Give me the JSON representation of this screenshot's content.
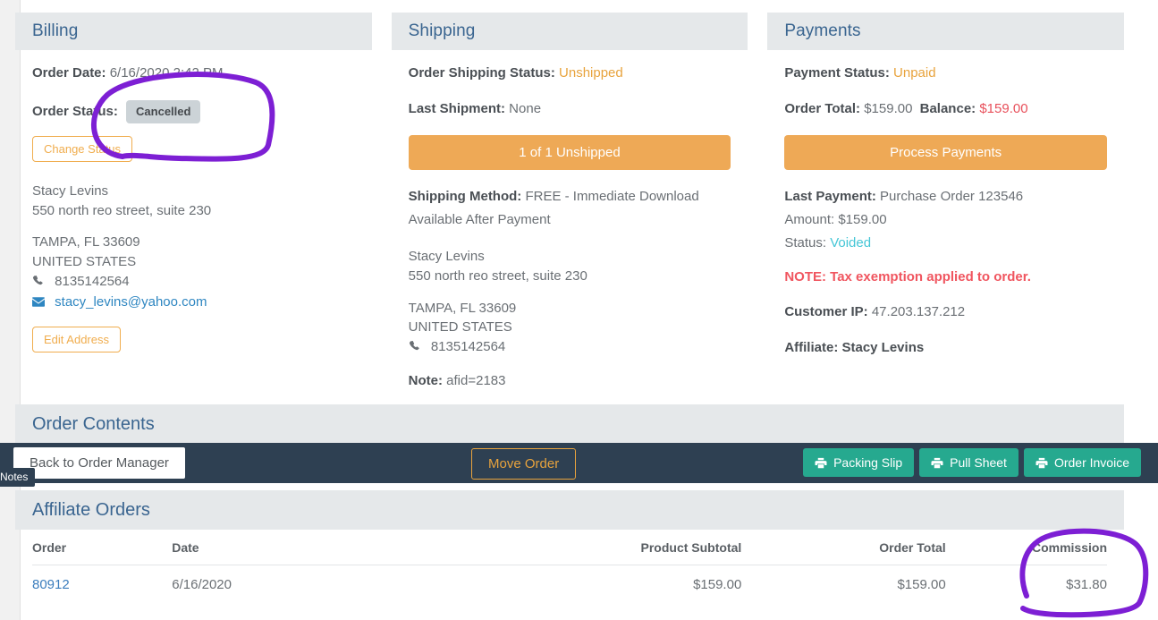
{
  "billing": {
    "title": "Billing",
    "order_date_label": "Order Date:",
    "order_date_value": "6/16/2020 2:42 PM",
    "order_status_label": "Order Status:",
    "order_status_value": "Cancelled",
    "change_status_button": "Change Status",
    "address": {
      "name": "Stacy Levins",
      "street": "550 north reo street, suite 230",
      "city_state_zip": "TAMPA, FL 33609",
      "country": "UNITED STATES",
      "phone": "8135142564",
      "email": "stacy_levins@yahoo.com"
    },
    "edit_address_button": "Edit Address"
  },
  "shipping": {
    "title": "Shipping",
    "status_label": "Order Shipping Status:",
    "status_value": "Unshipped",
    "last_shipment_label": "Last Shipment:",
    "last_shipment_value": "None",
    "unshipped_button": "1 of 1 Unshipped",
    "method_label": "Shipping Method:",
    "method_value": "FREE - Immediate Download",
    "method_value_2": "Available After Payment",
    "address": {
      "name": "Stacy Levins",
      "street": "550 north reo street, suite 230",
      "city_state_zip": "TAMPA, FL 33609",
      "country": "UNITED STATES",
      "phone": "8135142564"
    },
    "note_label": "Note:",
    "note_value": "afid=2183"
  },
  "payments": {
    "title": "Payments",
    "payment_status_label": "Payment Status:",
    "payment_status_value": "Unpaid",
    "order_total_label": "Order Total:",
    "order_total_value": "$159.00",
    "balance_label": "Balance:",
    "balance_value": "$159.00",
    "process_payments_button": "Process Payments",
    "last_payment_label": "Last Payment:",
    "last_payment_value": "Purchase Order 123546",
    "amount_line": "Amount: $159.00",
    "status_line_label": "Status:",
    "status_line_value": "Voided",
    "tax_note": "NOTE: Tax exemption applied to order.",
    "customer_ip_label": "Customer IP:",
    "customer_ip_value": "47.203.137.212",
    "affiliate_line": "Affiliate: Stacy Levins"
  },
  "order_contents": {
    "title": "Order Contents"
  },
  "toolbar": {
    "back_button": "Back to Order Manager",
    "notes_badge": "Notes",
    "move_order_button": "Move Order",
    "packing_slip_button": "Packing Slip",
    "pull_sheet_button": "Pull Sheet",
    "order_invoice_button": "Order Invoice"
  },
  "affiliate_orders": {
    "title": "Affiliate Orders",
    "columns": [
      "Order",
      "Date",
      "Product Subtotal",
      "Order Total",
      "Commission"
    ],
    "rows": [
      {
        "order": "80912",
        "date": "6/16/2020",
        "product_subtotal": "$159.00",
        "order_total": "$159.00",
        "commission": "$31.80"
      }
    ]
  },
  "colors": {
    "accent_orange": "#eea956",
    "teal": "#26a98f",
    "navy": "#2e4052",
    "title_blue": "#3a6590",
    "header_bg": "#e5e8ea",
    "danger_red": "#e8505b",
    "annotation_purple": "#7d1fd4"
  }
}
